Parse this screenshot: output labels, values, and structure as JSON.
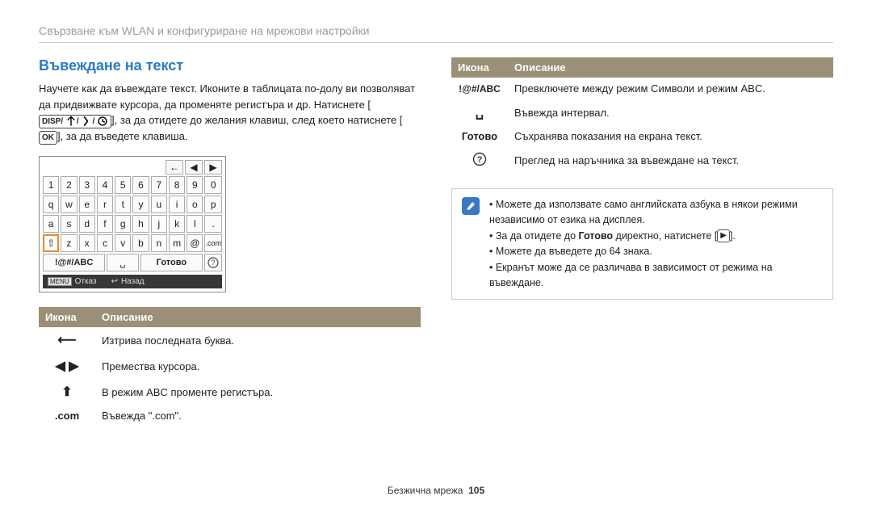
{
  "breadcrumb": "Свързване към WLAN и конфигуриране на мрежови настройки",
  "section_title": "Въвеждане на текст",
  "intro_part1": "Научете как да въвеждате текст. Иконите в таблицата по-долу ви позволяват да придвижвате курсора, да променяте регистъра и др. Натиснете [",
  "intro_disp": "DISP",
  "intro_part2": "], за да отидете до желания клавиш, след което натиснете [",
  "intro_ok": "OK",
  "intro_part3": "], за да въведете клавиша.",
  "keyboard": {
    "top_arrows": [
      "←",
      "◀",
      "▶"
    ],
    "rows": [
      [
        "1",
        "2",
        "3",
        "4",
        "5",
        "6",
        "7",
        "8",
        "9",
        "0"
      ],
      [
        "q",
        "w",
        "e",
        "r",
        "t",
        "y",
        "u",
        "i",
        "o",
        "p"
      ],
      [
        "a",
        "s",
        "d",
        "f",
        "g",
        "h",
        "j",
        "k",
        "l",
        "."
      ],
      [
        "⇧",
        "z",
        "x",
        "c",
        "v",
        "b",
        "n",
        "m",
        "@",
        ".com"
      ]
    ],
    "selected_key": "⇧",
    "bottom": {
      "abc": "!@#/ABC",
      "space": "␣",
      "done": "Готово",
      "help": "?"
    },
    "footer": {
      "menu": "MENU",
      "cancel": "Отказ",
      "back_icon": "↩",
      "back": "Назад"
    }
  },
  "table_headers": {
    "icon": "Икона",
    "desc": "Описание"
  },
  "left_table": [
    {
      "icon": "backspace",
      "desc": "Изтрива последната буква."
    },
    {
      "icon": "move",
      "desc": "Премества курсора."
    },
    {
      "icon": "shift",
      "desc": "В режим ABC променте регистъра."
    },
    {
      "icon": ".com",
      "desc": "Въвежда \".com\"."
    }
  ],
  "right_table": [
    {
      "icon": "!@#/ABC",
      "desc": "Превключете между режим Символи и режим ABC."
    },
    {
      "icon": "space",
      "desc": "Въвежда интервал."
    },
    {
      "icon": "Готово",
      "desc": "Съхранява показания на екрана текст."
    },
    {
      "icon": "help",
      "desc": "Преглед на наръчника за въвеждане на текст."
    }
  ],
  "notes": [
    "Можете да използвате само английската азбука в някои режими независимо от езика на дисплея.",
    "За да отидете до Готово директно, натиснете [▶].",
    "Можете да въведете до 64 знака.",
    "Екранът може да се различава в зависимост от режима на въвеждане."
  ],
  "note_bold_word": "Готово",
  "footer": {
    "label": "Безжична мрежа",
    "page": "105"
  }
}
